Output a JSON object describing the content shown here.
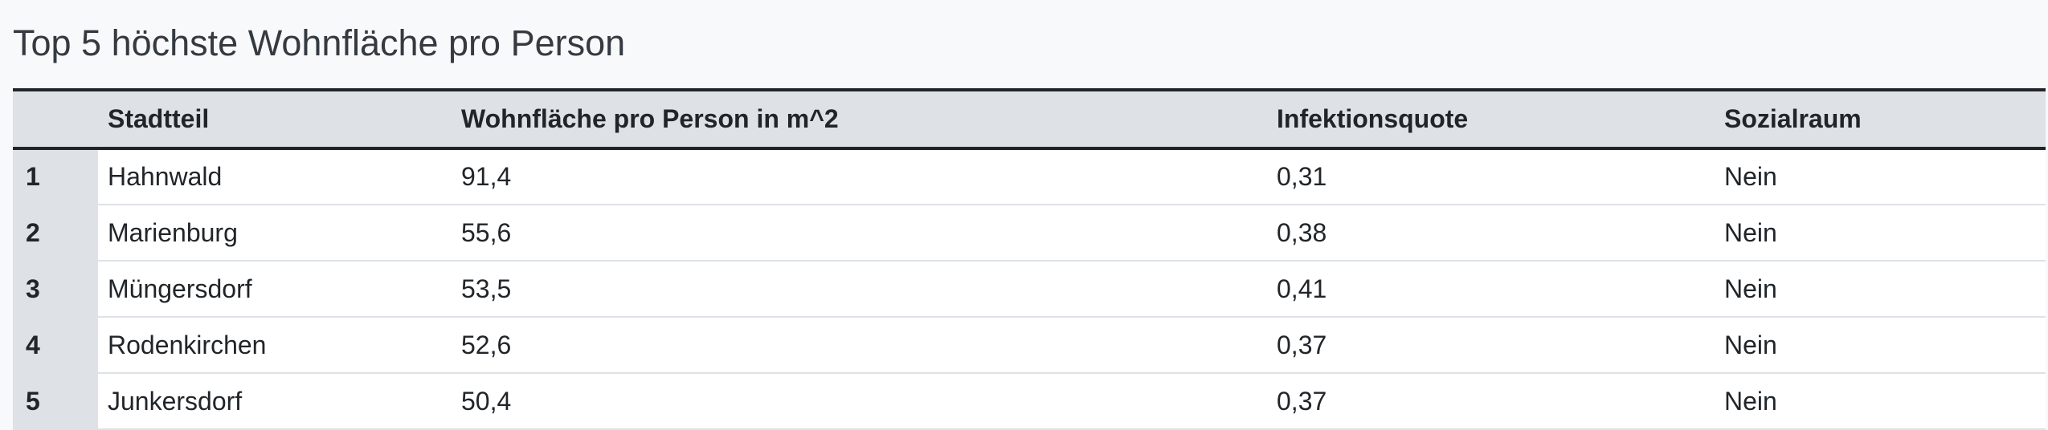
{
  "page": {
    "title": "Top 5 höchste Wohnfläche pro Person"
  },
  "table": {
    "headers": [
      "",
      "Stadtteil",
      "Wohnfläche pro Person in m^2",
      "Infektionsquote",
      "Sozialraum"
    ],
    "rows": [
      {
        "rank": "1",
        "stadtteil": "Hahnwald",
        "wohnflaeche": "91,4",
        "infektionsquote": "0,31",
        "sozialraum": "Nein"
      },
      {
        "rank": "2",
        "stadtteil": "Marienburg",
        "wohnflaeche": "55,6",
        "infektionsquote": "0,38",
        "sozialraum": "Nein"
      },
      {
        "rank": "3",
        "stadtteil": "Müngersdorf",
        "wohnflaeche": "53,5",
        "infektionsquote": "0,41",
        "sozialraum": "Nein"
      },
      {
        "rank": "4",
        "stadtteil": "Rodenkirchen",
        "wohnflaeche": "52,6",
        "infektionsquote": "0,37",
        "sozialraum": "Nein"
      },
      {
        "rank": "5",
        "stadtteil": "Junkersdorf",
        "wohnflaeche": "50,4",
        "infektionsquote": "0,37",
        "sozialraum": "Nein"
      }
    ]
  },
  "colors": {
    "header_bg": "#dee2e6",
    "border_dark": "#212529",
    "page_bg": "#f8f9fa"
  }
}
